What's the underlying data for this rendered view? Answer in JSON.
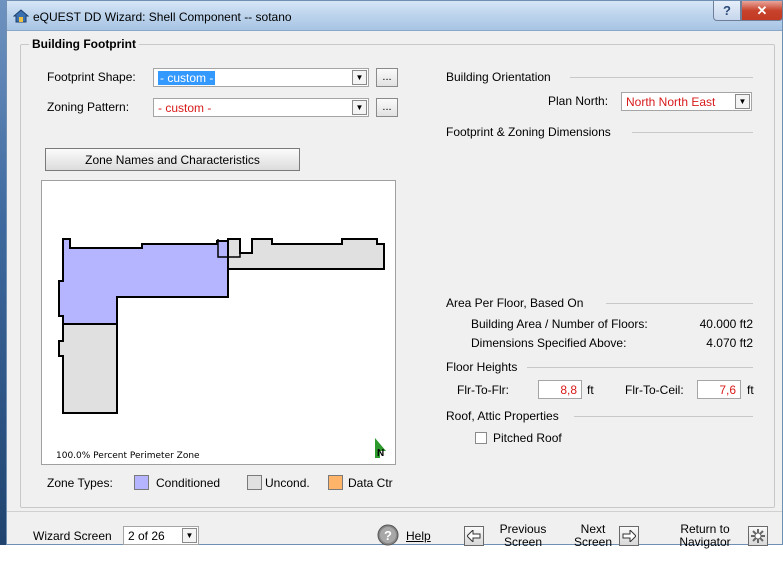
{
  "window": {
    "title": "eQUEST DD Wizard:  Shell Component  --  sotano",
    "help_glyph": "?",
    "close_glyph": "✕"
  },
  "footprint": {
    "legend": "Building Footprint",
    "shape_label": "Footprint Shape:",
    "shape_value": "- custom -",
    "zoning_label": "Zoning Pattern:",
    "zoning_value": "- custom -",
    "ellipsis": "...",
    "zone_button": "Zone Names and Characteristics",
    "perimeter_label": "100.0% Percent Perimeter Zone",
    "north_label": "N"
  },
  "zone_types": {
    "label": "Zone Types:",
    "items": [
      {
        "label": "Conditioned",
        "color": "#b4b4ff"
      },
      {
        "label": "Uncond.",
        "color": "#e0e0e0"
      },
      {
        "label": "Data Ctr",
        "color": "#ffb46a"
      }
    ]
  },
  "orientation": {
    "title": "Building Orientation",
    "plan_north_label": "Plan North:",
    "plan_north_value": "North North East"
  },
  "dimensions": {
    "title": "Footprint & Zoning Dimensions"
  },
  "area": {
    "title": "Area Per Floor, Based On",
    "rows": [
      {
        "label": "Building Area / Number of Floors:",
        "value": "40.000 ft2"
      },
      {
        "label": "Dimensions Specified Above:",
        "value": "4.070 ft2"
      }
    ]
  },
  "floor_heights": {
    "title": "Floor Heights",
    "flr_to_flr_label": "Flr-To-Flr:",
    "flr_to_flr_value": "8,8",
    "flr_to_ceil_label": "Flr-To-Ceil:",
    "flr_to_ceil_value": "7,6",
    "unit": "ft"
  },
  "roof": {
    "title": "Roof, Attic Properties",
    "pitched_label": "Pitched Roof",
    "pitched_checked": false
  },
  "footer": {
    "wizard_screen_label": "Wizard Screen",
    "wizard_screen_value": "2 of 26",
    "help_label": "Help",
    "prev_line1": "Previous",
    "prev_line2": "Screen",
    "next_line1": "Next",
    "next_line2": "Screen",
    "return_line1": "Return to",
    "return_line2": "Navigator"
  },
  "colors": {
    "accent_red": "#d81b1b",
    "selection_blue": "#3399ff"
  }
}
